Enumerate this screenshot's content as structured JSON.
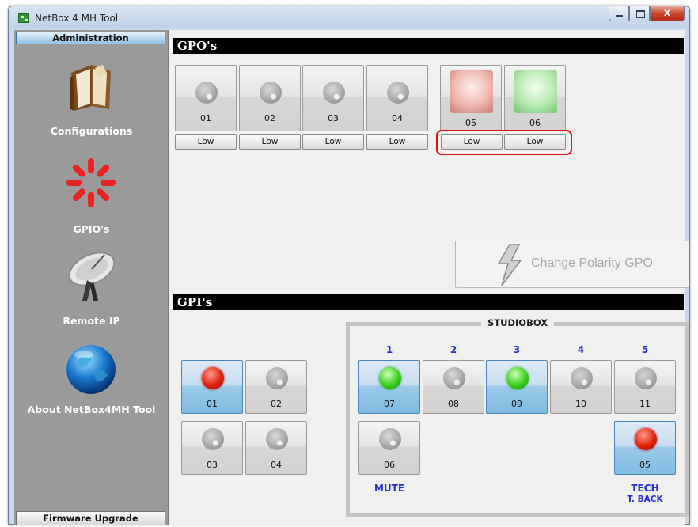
{
  "window": {
    "title": "NetBox 4 MH Tool",
    "close_glyph": "x"
  },
  "sidebar": {
    "header": "Administration",
    "footer": "Firmware Upgrade",
    "items": [
      {
        "label": "Configurations",
        "icon": "book-icon"
      },
      {
        "label": "GPIO's",
        "icon": "spinner-icon"
      },
      {
        "label": "Remote IP",
        "icon": "satellite-dish-icon"
      },
      {
        "label": "About NetBox4MH Tool",
        "icon": "globe-icon"
      }
    ]
  },
  "gpo": {
    "title": "GPO's",
    "outputs": [
      {
        "label": "01",
        "state": "Low"
      },
      {
        "label": "02",
        "state": "Low"
      },
      {
        "label": "03",
        "state": "Low"
      },
      {
        "label": "04",
        "state": "Low"
      },
      {
        "label": "05",
        "state": "Low"
      },
      {
        "label": "06",
        "state": "Low"
      }
    ],
    "change_polarity_label": "Change Polarity GPO"
  },
  "gpi": {
    "title": "GPI's",
    "inputs": [
      {
        "label": "01",
        "led": "red"
      },
      {
        "label": "02",
        "led": "grey"
      },
      {
        "label": "03",
        "led": "grey"
      },
      {
        "label": "04",
        "led": "grey"
      }
    ],
    "studiobox": {
      "title": "STUDIOBOX",
      "columns": [
        "1",
        "2",
        "3",
        "4",
        "5"
      ],
      "inputs": [
        {
          "label": "07",
          "led": "green"
        },
        {
          "label": "08",
          "led": "grey"
        },
        {
          "label": "09",
          "led": "green"
        },
        {
          "label": "10",
          "led": "grey"
        },
        {
          "label": "11",
          "led": "grey"
        },
        {
          "label": "06",
          "led": "grey"
        },
        {
          "label": "05",
          "led": "red"
        }
      ],
      "mute_label": "MUTE",
      "tech_label": "TECH",
      "tback_label": "T. BACK"
    }
  },
  "colors": {
    "accent_blue": "#2330d8",
    "highlight_red": "#e01010"
  }
}
